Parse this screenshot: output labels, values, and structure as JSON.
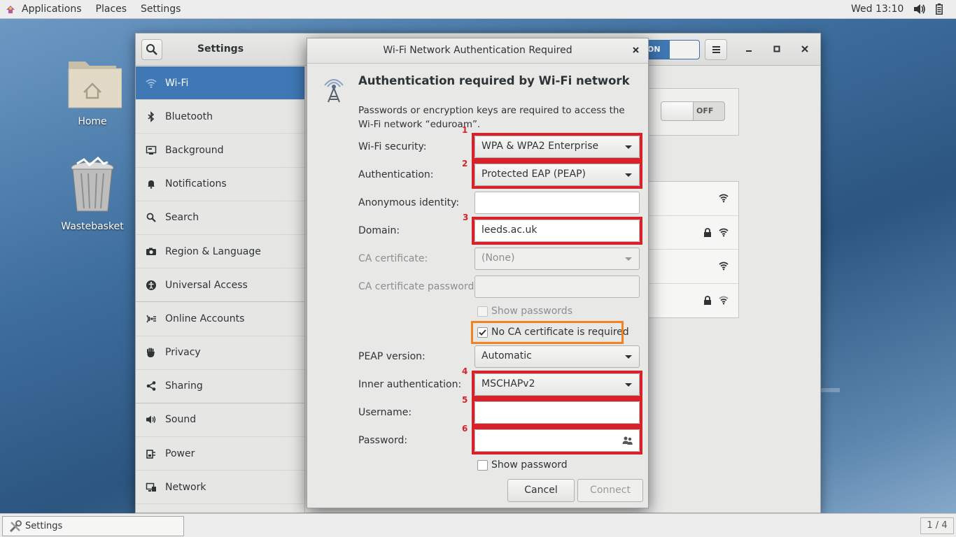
{
  "topbar": {
    "applications": "Applications",
    "places": "Places",
    "settings": "Settings",
    "clock": "Wed 13:10"
  },
  "desktop": {
    "home": "Home",
    "wastebasket": "Wastebasket"
  },
  "settings_window": {
    "title": "Settings",
    "toggle_on": "ON",
    "sidebar": [
      {
        "label": "Wi-Fi",
        "icon": "wifi-icon"
      },
      {
        "label": "Bluetooth",
        "icon": "bluetooth-icon"
      },
      {
        "label": "Background",
        "icon": "background-icon"
      },
      {
        "label": "Notifications",
        "icon": "bell-icon"
      },
      {
        "label": "Search",
        "icon": "search-icon"
      },
      {
        "label": "Region & Language",
        "icon": "camera-icon"
      },
      {
        "label": "Universal Access",
        "icon": "accessibility-icon"
      },
      {
        "label": "Online Accounts",
        "icon": "online-accounts-icon"
      },
      {
        "label": "Privacy",
        "icon": "hand-icon"
      },
      {
        "label": "Sharing",
        "icon": "share-icon"
      },
      {
        "label": "Sound",
        "icon": "speaker-icon"
      },
      {
        "label": "Power",
        "icon": "power-icon"
      },
      {
        "label": "Network",
        "icon": "network-icon"
      }
    ],
    "wifi_off": "OFF"
  },
  "dialog": {
    "title": "Wi-Fi Network Authentication Required",
    "heading": "Authentication required by Wi-Fi network",
    "message": "Passwords or encryption keys are required to access the Wi-Fi network “eduroam”.",
    "wifi_security_label": "Wi-Fi security:",
    "wifi_security_value": "WPA & WPA2 Enterprise",
    "authentication_label": "Authentication:",
    "authentication_value": "Protected EAP (PEAP)",
    "anonymous_identity_label": "Anonymous identity:",
    "anonymous_identity_value": "",
    "domain_label": "Domain:",
    "domain_value": "leeds.ac.uk",
    "ca_certificate_label": "CA certificate:",
    "ca_certificate_value": "(None)",
    "ca_password_label": "CA certificate password:",
    "show_passwords_label": "Show passwords",
    "no_ca_label": "No CA certificate is required",
    "peap_version_label": "PEAP version:",
    "peap_version_value": "Automatic",
    "inner_auth_label": "Inner authentication:",
    "inner_auth_value": "MSCHAPv2",
    "username_label": "Username:",
    "username_value": "",
    "password_label": "Password:",
    "password_value": "",
    "show_password_label": "Show password",
    "cancel": "Cancel",
    "connect": "Connect"
  },
  "annotations": [
    "1",
    "2",
    "3",
    "4",
    "5",
    "6"
  ],
  "bottombar": {
    "task": "Settings",
    "workspace": "1 / 4"
  },
  "colors": {
    "accent": "#3f78b5",
    "highlight_red": "#d6222a",
    "highlight_orange": "#f58220"
  }
}
